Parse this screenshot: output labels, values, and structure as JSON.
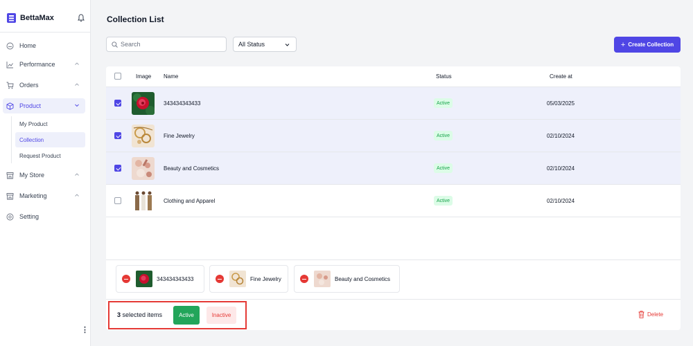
{
  "brand": {
    "name": "BettaMax"
  },
  "sidebar": {
    "items": [
      {
        "label": "Home",
        "icon": "home-icon"
      },
      {
        "label": "Performance",
        "icon": "chart-icon"
      },
      {
        "label": "Orders",
        "icon": "cart-icon"
      },
      {
        "label": "Product",
        "icon": "box-icon"
      },
      {
        "label": "My Store",
        "icon": "store-icon"
      },
      {
        "label": "Marketing",
        "icon": "store-icon"
      },
      {
        "label": "Setting",
        "icon": "gear-icon"
      }
    ],
    "product_sub": [
      {
        "label": "My Product"
      },
      {
        "label": "Collection"
      },
      {
        "label": "Request Product"
      }
    ],
    "active_item": "Product",
    "active_sub": "Collection",
    "more_label": "⋮"
  },
  "header": {
    "title": "Collection List",
    "search_placeholder": "Search",
    "status_filter": "All Status",
    "create_button": "Create Collection"
  },
  "table": {
    "columns": {
      "image": "Image",
      "name": "Name",
      "status": "Status",
      "created": "Create at"
    },
    "rows": [
      {
        "name": "343434343433",
        "status": "Active",
        "created": "05/03/2025",
        "selected": true,
        "thumb": "rose"
      },
      {
        "name": "Fine Jewelry",
        "status": "Active",
        "created": "02/10/2024",
        "selected": true,
        "thumb": "jewelry"
      },
      {
        "name": "Beauty and Cosmetics",
        "status": "Active",
        "created": "02/10/2024",
        "selected": true,
        "thumb": "cosmetics"
      },
      {
        "name": "Clothing and Apparel",
        "status": "Active",
        "created": "02/10/2024",
        "selected": false,
        "thumb": "clothing"
      }
    ]
  },
  "selected_chips": [
    {
      "label": "343434343433"
    },
    {
      "label": "Fine Jewelry"
    },
    {
      "label": "Beauty and Cosmetics"
    }
  ],
  "bulk_actions": {
    "count": "3",
    "count_suffix": " selected items",
    "active_label": "Active",
    "inactive_label": "Inactive",
    "delete_label": "Delete"
  },
  "colors": {
    "accent": "#4f46e5",
    "active_green": "#22a55a",
    "danger": "#e53935",
    "selected_row": "#eef0fb"
  }
}
